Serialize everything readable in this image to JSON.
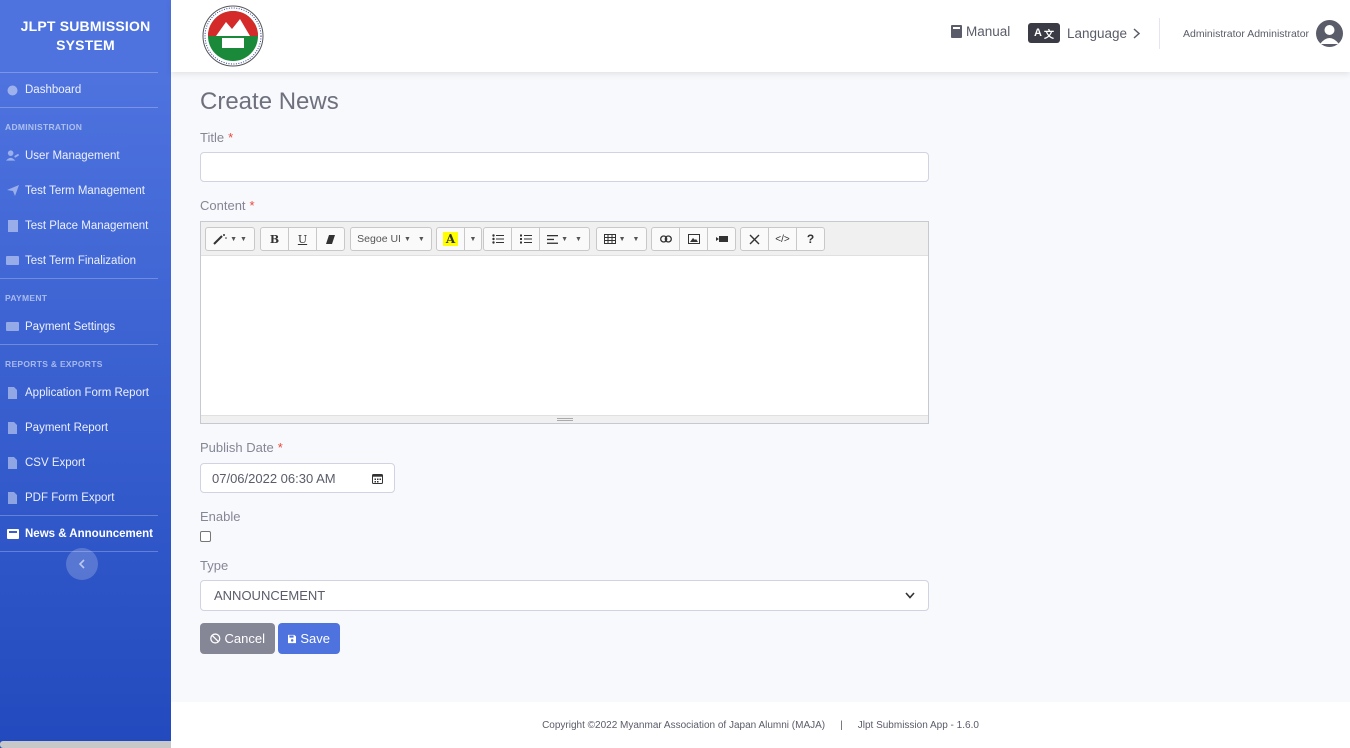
{
  "sidebar": {
    "brand": "JLPT SUBMISSION SYSTEM",
    "dashboard": "Dashboard",
    "headings": {
      "administration": "ADMINISTRATION",
      "payment": "PAYMENT",
      "reports": "REPORTS & EXPORTS"
    },
    "admin_items": [
      "User Management",
      "Test Term Management",
      "Test Place Management",
      "Test Term Finalization"
    ],
    "payment_items": [
      "Payment Settings"
    ],
    "report_items": [
      "Application Form Report",
      "Payment Report",
      "CSV Export",
      "PDF Form Export"
    ],
    "active_item": "News & Announcement"
  },
  "topbar": {
    "manual": "Manual",
    "language": "Language",
    "user": "Administrator Administrator"
  },
  "form": {
    "page_title": "Create News",
    "title_label": "Title",
    "title_value": "",
    "content_label": "Content",
    "editor": {
      "font_name": "Segoe UI",
      "help": "?",
      "code": "</>"
    },
    "publish_label": "Publish Date",
    "publish_value": "07/06/2022 06:30 AM",
    "enable_label": "Enable",
    "enable_checked": false,
    "type_label": "Type",
    "type_value": "ANNOUNCEMENT",
    "cancel_label": "Cancel",
    "save_label": "Save"
  },
  "footer": {
    "copyright": "Copyright ©2022 Myanmar Association of Japan Alumni (MAJA)",
    "separator": "|",
    "app": "Jlpt Submission App - 1.6.0"
  },
  "colors": {
    "primary": "#4e73df",
    "secondary": "#858796",
    "danger": "#e74a3b"
  }
}
